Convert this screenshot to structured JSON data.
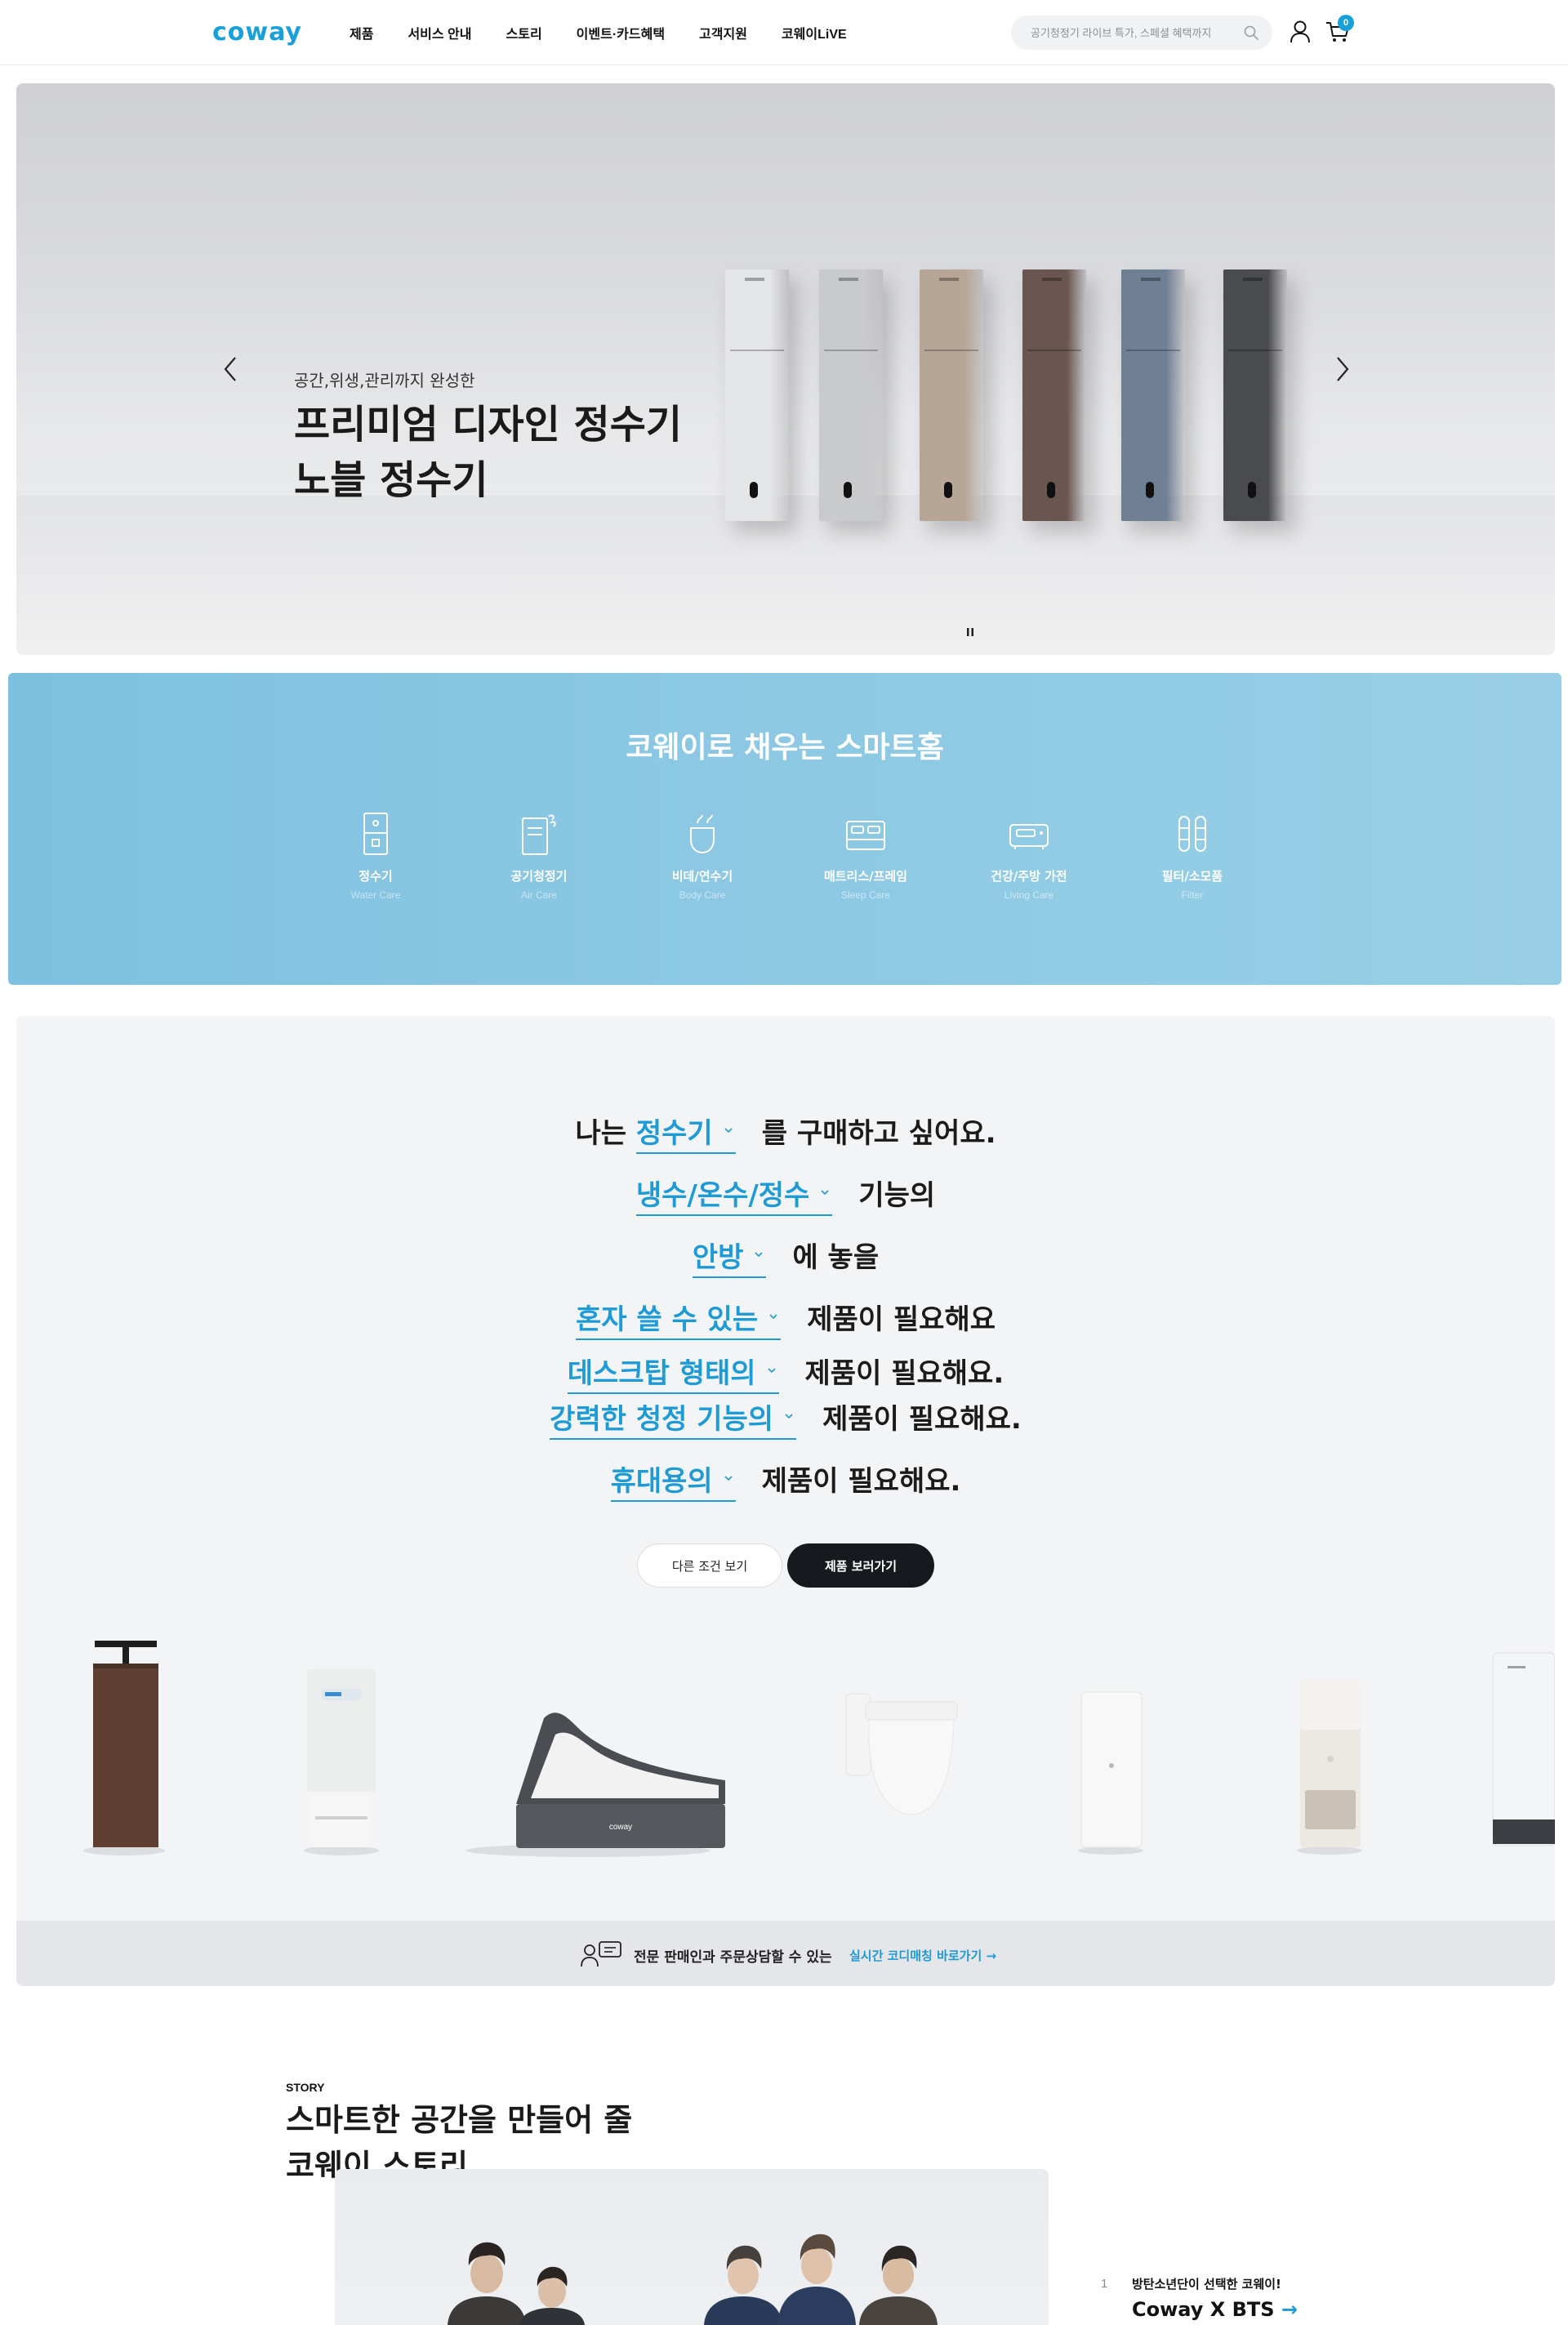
{
  "header": {
    "logo": "coway",
    "nav": [
      "제품",
      "서비스 안내",
      "스토리",
      "이벤트·카드혜택",
      "고객지원",
      "코웨이LiVE"
    ],
    "search_placeholder": "공기청정기 라이브 특가, 스페셜 혜택까지",
    "cart_count": "0"
  },
  "hero": {
    "subtitle": "공간,위생,관리까지 완성한",
    "title_line1": "프리미엄 디자인 정수기",
    "title_line2": "노블 정수기",
    "product_colors": [
      "#e4e5e7",
      "#c9cacc",
      "#b7a595",
      "#6a5551",
      "#6f7f94",
      "#4a4b4e"
    ]
  },
  "smart_home": {
    "title": "코웨이로 채우는 스마트홈",
    "categories": [
      {
        "name": "정수기",
        "en": "Water Care",
        "icon": "water-purifier-icon"
      },
      {
        "name": "공기청정기",
        "en": "Air Care",
        "icon": "air-purifier-icon"
      },
      {
        "name": "비데/연수기",
        "en": "Body Care",
        "icon": "bidet-icon"
      },
      {
        "name": "매트리스/프레임",
        "en": "Sleep Care",
        "icon": "bed-icon"
      },
      {
        "name": "건강/주방 가전",
        "en": "Living Care",
        "icon": "kitchen-appliance-icon"
      },
      {
        "name": "필터/소모품",
        "en": "Filter",
        "icon": "filter-icon"
      }
    ]
  },
  "finder": {
    "line1": {
      "pre": "나는",
      "sel": "정수기",
      "post": "를 구매하고 싶어요."
    },
    "line2": {
      "sel": "냉수/온수/정수",
      "post": "기능의"
    },
    "line3": {
      "sel": "안방",
      "post": "에 놓을"
    },
    "line4": {
      "sel": "혼자 쓸 수 있는",
      "post": "제품이 필요해요"
    },
    "line5": {
      "sel": "데스크탑 형태의",
      "post": "제품이 필요해요."
    },
    "line6": {
      "sel": "강력한 청정 기능의",
      "post": "제품이 필요해요."
    },
    "line7": {
      "sel": "휴대용의",
      "post": "제품이 필요해요."
    },
    "btn_other": "다른 조건 보기",
    "btn_view": "제품 보러가기",
    "mattress_brand": "coway"
  },
  "consult": {
    "text": "전문 판매인과 주문상담할 수 있는",
    "link": "실시간 코디매칭 바로가기 →"
  },
  "story": {
    "tag": "STORY",
    "title_line1": "스마트한 공간을 만들어 줄",
    "title_line2": "코웨이 스토리",
    "item_num": "1",
    "item_sub": "방탄소년단이 선택한 코웨이!",
    "item_title": "Coway X BTS",
    "item_arrow": "→"
  }
}
